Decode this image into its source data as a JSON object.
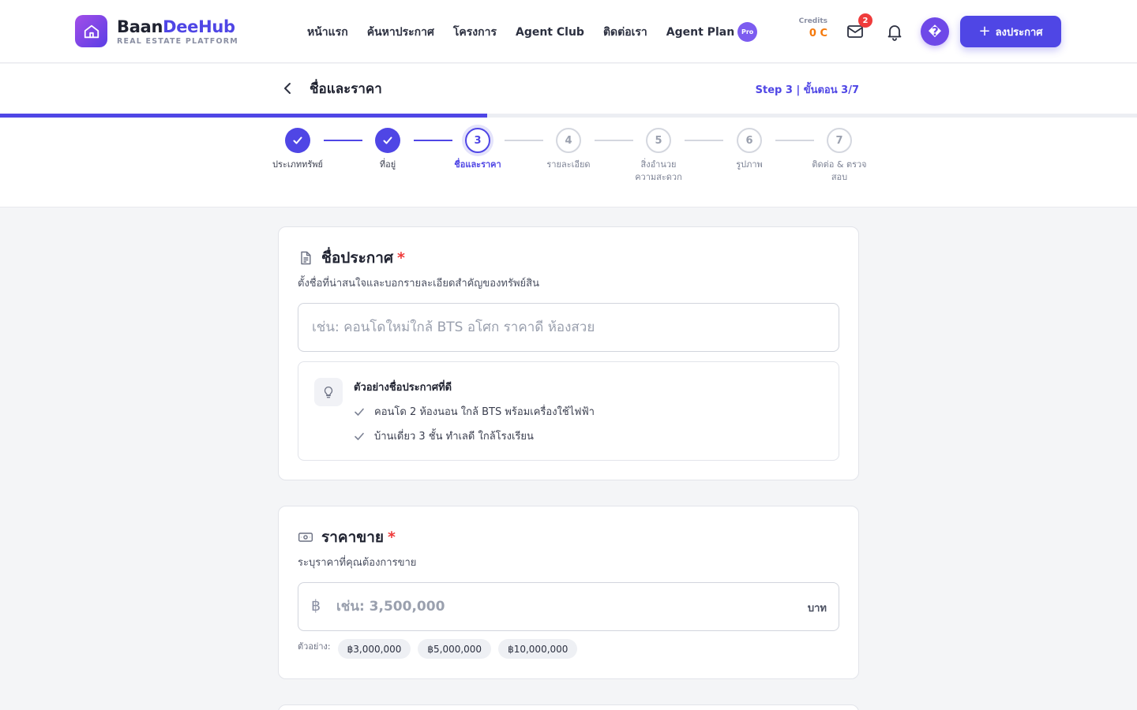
{
  "brand": {
    "name_a": "Baan",
    "name_b": "DeeHub",
    "tagline": "REAL ESTATE PLATFORM"
  },
  "nav": {
    "items": [
      "หน้าแรก",
      "ค้นหาประกาศ",
      "โครงการ",
      "Agent Club",
      "ติดต่อเรา"
    ],
    "plan_label": "Agent Plan",
    "plan_badge": "Pro"
  },
  "header": {
    "credits_label": "Credits",
    "credits_value": "0 C",
    "mail_count": "2",
    "avatar_glyph": "�",
    "post_button_label": "ลงประกาศ"
  },
  "step_header": {
    "title": "ชื่อและราคา",
    "counter": "Step 3 | ขั้นตอน 3/7",
    "progress_fraction": 0.4286
  },
  "steps": [
    {
      "num": "1",
      "label": "ประเภททรัพย์",
      "status": "done"
    },
    {
      "num": "2",
      "label": "ที่อยู่",
      "status": "done"
    },
    {
      "num": "3",
      "label": "ชื่อและราคา",
      "status": "active"
    },
    {
      "num": "4",
      "label": "รายละเอียด",
      "status": "todo"
    },
    {
      "num": "5",
      "label": "สิ่งอำนวยความสะดวก",
      "status": "todo"
    },
    {
      "num": "6",
      "label": "รูปภาพ",
      "status": "todo"
    },
    {
      "num": "7",
      "label": "ติดต่อ & ตรวจสอบ",
      "status": "todo"
    }
  ],
  "title_card": {
    "heading": "ชื่อประกาศ",
    "required_mark": "*",
    "description": "ตั้งชื่อที่น่าสนใจและบอกรายละเอียดสำคัญของทรัพย์สิน",
    "input_value": "",
    "input_placeholder": "เช่น: คอนโดใหม่ใกล้ BTS อโศก ราคาดี ห้องสวย",
    "tips_title": "ตัวอย่างชื่อประกาศที่ดี",
    "tips": [
      "คอนโด 2 ห้องนอน ใกล้ BTS พร้อมเครื่องใช้ไฟฟ้า",
      "บ้านเดี่ยว 3 ชั้น ทำเลดี ใกล้โรงเรียน"
    ]
  },
  "price_card": {
    "heading": "ราคาขาย",
    "required_mark": "*",
    "description": "ระบุราคาที่คุณต้องการขาย",
    "currency_symbol": "฿",
    "input_value": "",
    "input_placeholder": "เช่น: 3,500,000",
    "unit": "บาท",
    "examples_label": "ตัวอย่าง:",
    "examples": [
      "฿3,000,000",
      "฿5,000,000",
      "฿10,000,000"
    ]
  },
  "colors": {
    "primary": "#4f46e5",
    "required": "#ef3b3b",
    "credits": "#f5790b"
  }
}
